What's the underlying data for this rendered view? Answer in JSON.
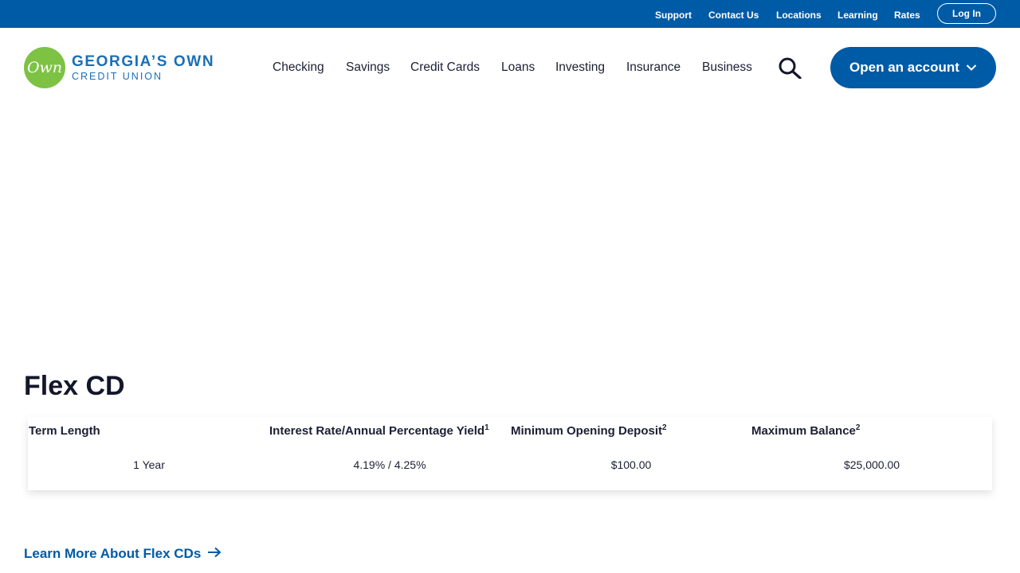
{
  "utility_nav": {
    "items": [
      "Support",
      "Contact Us",
      "Locations",
      "Learning",
      "Rates"
    ],
    "login_label": "Log In"
  },
  "logo": {
    "mark": "Own",
    "line1": "GEORGIA’S OWN",
    "line2": "CREDIT UNION"
  },
  "main_nav": {
    "items": [
      "Checking",
      "Savings",
      "Credit Cards",
      "Loans",
      "Investing",
      "Insurance",
      "Business"
    ],
    "search_icon": "search-icon",
    "open_account_label": "Open an account"
  },
  "content": {
    "title": "Flex CD",
    "table": {
      "headers": [
        {
          "label": "Term Length",
          "sup": ""
        },
        {
          "label": "Interest Rate/Annual Percentage Yield",
          "sup": "1"
        },
        {
          "label": "Minimum Opening Deposit",
          "sup": "2"
        },
        {
          "label": "Maximum Balance",
          "sup": "2"
        }
      ],
      "rows": [
        [
          "1 Year",
          "4.19% / 4.25%",
          "$100.00",
          "$25,000.00"
        ]
      ]
    },
    "learn_more_label": "Learn More About Flex CDs"
  },
  "colors": {
    "brand_blue": "#005ba6",
    "logo_green": "#7dc243"
  }
}
